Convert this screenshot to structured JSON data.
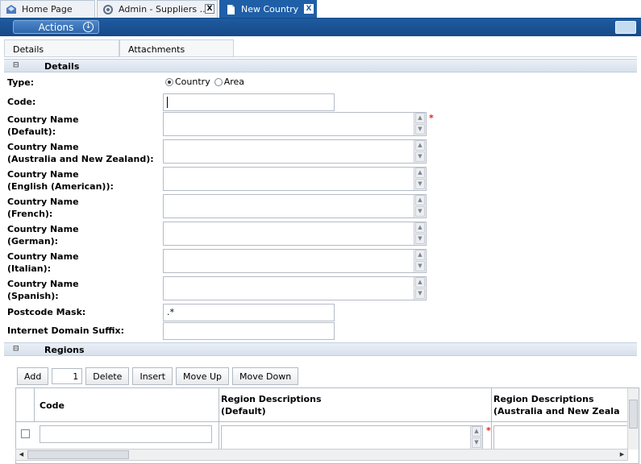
{
  "tabs": [
    {
      "label": "Home Page",
      "icon": "home-icon",
      "closable": false,
      "active": false
    },
    {
      "label": "Admin - Suppliers ..",
      "icon": "settings-icon",
      "closable": true,
      "active": false
    },
    {
      "label": "New Country",
      "icon": "document-icon",
      "closable": true,
      "active": true
    }
  ],
  "close_glyph": "X",
  "actions": {
    "label": "Actions"
  },
  "subtabs": [
    {
      "label": "Details"
    },
    {
      "label": "Attachments"
    }
  ],
  "details_section": {
    "title": "Details",
    "type": {
      "label": "Type:",
      "options": [
        "Country",
        "Area"
      ],
      "selected": "Country"
    },
    "code": {
      "label": "Code:",
      "value": ""
    },
    "country_names": [
      {
        "label_line1": "Country Name",
        "label_line2": "(Default):",
        "required": true,
        "value": ""
      },
      {
        "label_line1": "Country Name",
        "label_line2": "(Australia and New Zealand):",
        "required": false,
        "value": ""
      },
      {
        "label_line1": "Country Name",
        "label_line2": "(English (American)):",
        "required": false,
        "value": ""
      },
      {
        "label_line1": "Country Name",
        "label_line2": "(French):",
        "required": false,
        "value": ""
      },
      {
        "label_line1": "Country Name",
        "label_line2": "(German):",
        "required": false,
        "value": ""
      },
      {
        "label_line1": "Country Name",
        "label_line2": "(Italian):",
        "required": false,
        "value": ""
      },
      {
        "label_line1": "Country Name",
        "label_line2": "(Spanish):",
        "required": false,
        "value": ""
      }
    ],
    "postcode_mask": {
      "label": "Postcode Mask:",
      "value": ".*"
    },
    "internet_domain_suffix": {
      "label": "Internet Domain Suffix:",
      "value": ""
    }
  },
  "regions_section": {
    "title": "Regions",
    "toolbar": {
      "add_label": "Add",
      "add_count": "1",
      "delete_label": "Delete",
      "insert_label": "Insert",
      "move_up_label": "Move Up",
      "move_down_label": "Move Down"
    },
    "columns": [
      {
        "line1": "Code",
        "line2": ""
      },
      {
        "line1": "Region Descriptions",
        "line2": "(Default)"
      },
      {
        "line1": "Region Descriptions",
        "line2": "(Australia and New Zeala"
      }
    ],
    "rows": [
      {
        "checked": false,
        "code": "",
        "desc_default": "",
        "desc_anz": ""
      }
    ]
  },
  "required_mark": "*",
  "colors": {
    "accent": "#1f5fa8",
    "required": "#e02020"
  }
}
